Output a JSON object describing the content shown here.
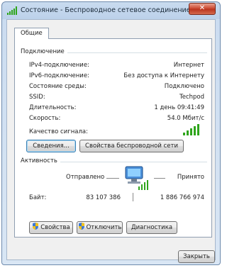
{
  "window": {
    "title": "Состояние - Беспроводное сетевое соединение",
    "close_glyph": "✕"
  },
  "tabs": [
    {
      "label": "Общие",
      "selected": true
    }
  ],
  "connection": {
    "section_label": "Подключение",
    "rows": [
      {
        "label": "IPv4-подключение:",
        "value": "Интернет"
      },
      {
        "label": "IPv6-подключение:",
        "value": "Без доступа к Интернету"
      },
      {
        "label": "Состояние среды:",
        "value": "Подключено"
      },
      {
        "label": "SSID:",
        "value": "Techpod"
      },
      {
        "label": "Длительность:",
        "value": "1 день 09:41:49"
      },
      {
        "label": "Скорость:",
        "value": "54.0 Мбит/с"
      }
    ],
    "signal_label": "Качество сигнала:",
    "signal_bars_lit": 5,
    "signal_bars_total": 5,
    "details_button": "Сведения...",
    "wireless_props_button": "Свойства беспроводной сети"
  },
  "activity": {
    "section_label": "Активность",
    "sent_label": "Отправлено",
    "received_label": "Принято",
    "bytes_label": "Байт:",
    "bytes_sent": "83 107 386",
    "bytes_received": "1 886 766 974"
  },
  "actions": {
    "properties_button": "Свойства",
    "disable_button": "Отключить",
    "diagnose_button": "Диагностика"
  },
  "footer": {
    "close_button": "Закрыть"
  },
  "colors": {
    "signal_green": "#2fa51c",
    "shield_blue": "#3b78d8",
    "shield_yellow": "#f2c21b"
  },
  "icons": [
    "wireless-signal-icon",
    "network-computers-icon",
    "shield-icon",
    "close-icon"
  ]
}
